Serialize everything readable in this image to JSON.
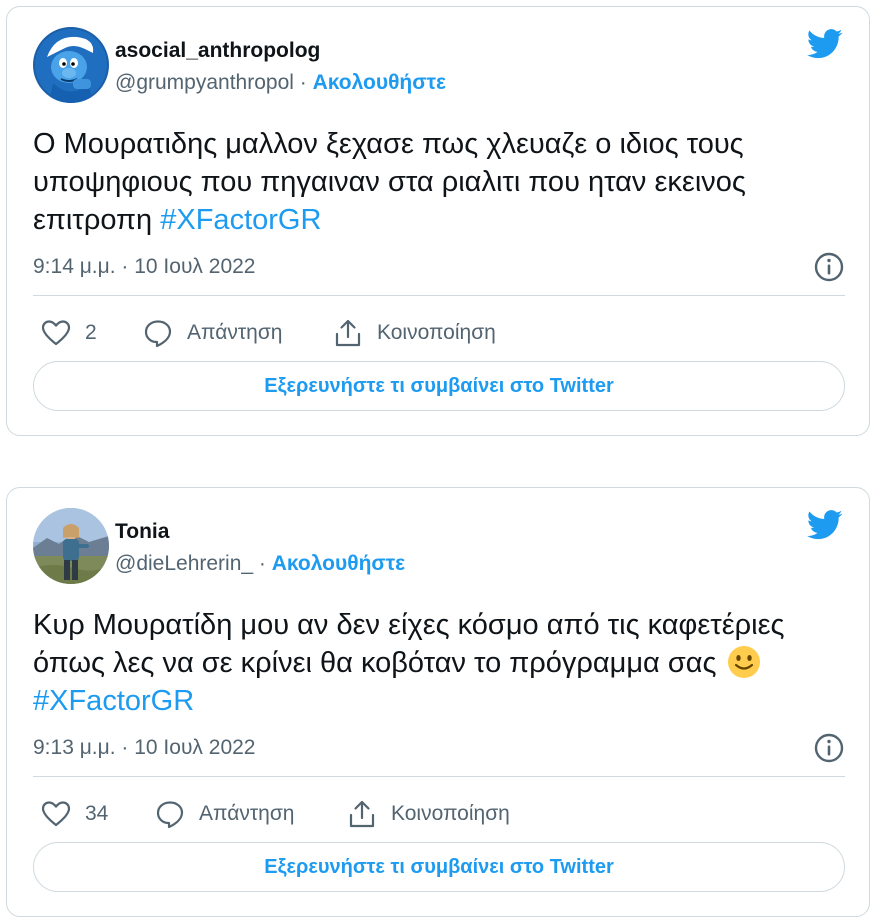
{
  "tweets": [
    {
      "author_name": "asocial_anthropolog",
      "handle": "@grumpyanthropol",
      "separator": "·",
      "follow_label": "Ακολουθήστε",
      "text": "Ο Μουρατιδης μαλλον ξεχασε πως χλευαζε ο ιδιος τους υποψηφιους που πηγαιναν στα ριαλιτι που ηταν εκεινος επιτροπη ",
      "hashtag": "#XFactorGR",
      "timestamp": "9:14 μ.μ. · 10 Ιουλ 2022",
      "like_count": "2",
      "reply_label": "Απάντηση",
      "share_label": "Κοινοποίηση",
      "explore_label": "Εξερευνήστε τι συμβαίνει στο Twitter",
      "avatar_icon": "smurf-avatar"
    },
    {
      "author_name": "Tonia",
      "handle": "@dieLehrerin_",
      "separator": "·",
      "follow_label": "Ακολουθήστε",
      "text": "Κυρ Μουρατίδη μου αν δεν είχες κόσμο από τις καφετέριες όπως λες να σε κρίνει θα κοβόταν το πρόγραμμα σας",
      "emoji": "slightly-smiling-face",
      "hashtag": "#XFactorGR",
      "timestamp": "9:13 μ.μ. · 10 Ιουλ 2022",
      "like_count": "34",
      "reply_label": "Απάντηση",
      "share_label": "Κοινοποίηση",
      "explore_label": "Εξερευνήστε τι συμβαίνει στο Twitter",
      "avatar_icon": "photo-avatar"
    }
  ],
  "colors": {
    "accent": "#1d9bf0",
    "text": "#0f1419",
    "muted": "#536471",
    "border": "#cfd9de"
  },
  "icons": [
    "twitter-bird-icon",
    "info-icon",
    "heart-icon",
    "reply-bubble-icon",
    "share-icon"
  ]
}
